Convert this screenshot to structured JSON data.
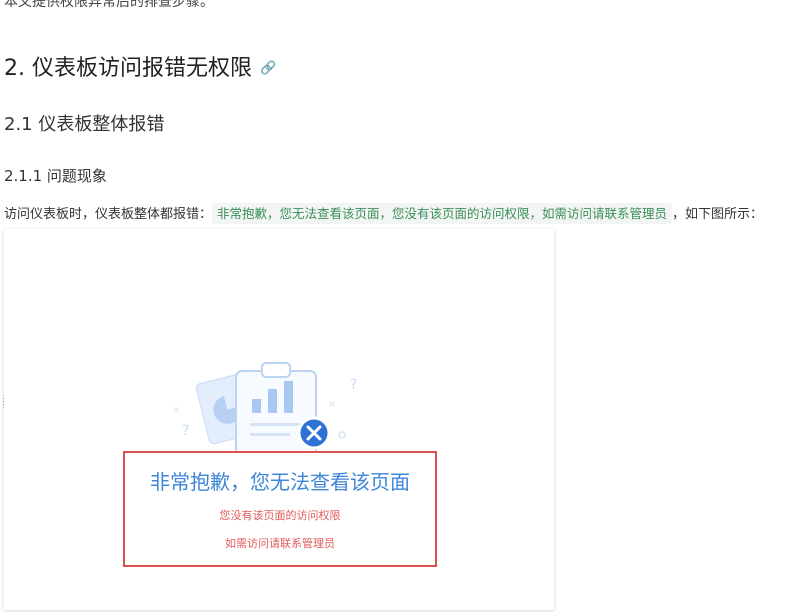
{
  "intro": "本文提供权限异常后的排查步骤。",
  "section_h2": "2. 仪表板访问报错无权限",
  "section_h3": "2.1 仪表板整体报错",
  "section_h4": "2.1.1 问题现象",
  "paragraph": {
    "before": "访问仪表板时，仪表板整体都报错：",
    "code": "非常抱歉，您无法查看该页面，您没有该页面的访问权限，如需访问请联系管理员",
    "after": "，如下图所示："
  },
  "screenshot": {
    "title": "非常抱歉，您无法查看该页面",
    "line1": "您没有该页面的访问权限",
    "line2": "如需访问请联系管理员"
  },
  "icons": {
    "heading_link": "link-icon",
    "error": "close-circle-icon"
  },
  "colors": {
    "code_text": "#3a8f5a",
    "notice_title": "#3d86d8",
    "notice_text": "#e05b5b",
    "highlight_border": "#d9534f",
    "error_badge": "#2f72d6"
  }
}
